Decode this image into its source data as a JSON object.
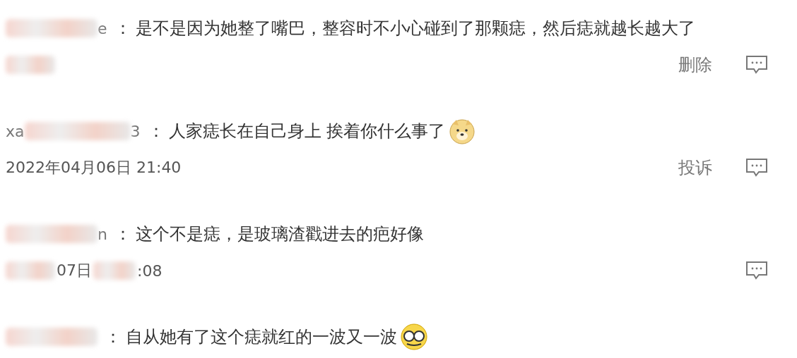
{
  "comments": [
    {
      "name": [
        {
          "kind": "blur"
        },
        {
          "kind": "text",
          "text": "e"
        }
      ],
      "separator": "：",
      "text": "是不是因为她整了嘴巴，整容时不小心碰到了那颗痣，然后痣就越长越大了",
      "date": [
        {
          "kind": "blur"
        }
      ],
      "actions": [
        {
          "kind": "label",
          "label": "删除"
        },
        {
          "kind": "reply"
        }
      ]
    },
    {
      "name": [
        {
          "kind": "text",
          "text": "xa"
        },
        {
          "kind": "blur"
        },
        {
          "kind": "text",
          "text": "3"
        }
      ],
      "separator": "：",
      "text": "人家痣长在自己身上 挨着你什么事了",
      "emoji": {
        "kind": "dog"
      },
      "date": [
        {
          "kind": "text",
          "text": "2022年04月06日 21:40"
        }
      ],
      "actions": [
        {
          "kind": "label",
          "label": "投诉"
        },
        {
          "kind": "reply"
        }
      ]
    },
    {
      "name": [
        {
          "kind": "blur"
        },
        {
          "kind": "text",
          "text": "n"
        }
      ],
      "separator": "：",
      "text": "这个不是痣，是玻璃渣戳进去的疤好像",
      "date": [
        {
          "kind": "blur"
        },
        {
          "kind": "text",
          "text": "07日"
        },
        {
          "kind": "blur"
        },
        {
          "kind": "text",
          "text": ":08"
        }
      ],
      "actions": [
        {
          "kind": "reply"
        }
      ]
    },
    {
      "name": [
        {
          "kind": "blur"
        }
      ],
      "separator": "：",
      "text": "自从她有了这个痣就红的一波又一波",
      "emoji": {
        "kind": "glasses"
      }
    }
  ]
}
